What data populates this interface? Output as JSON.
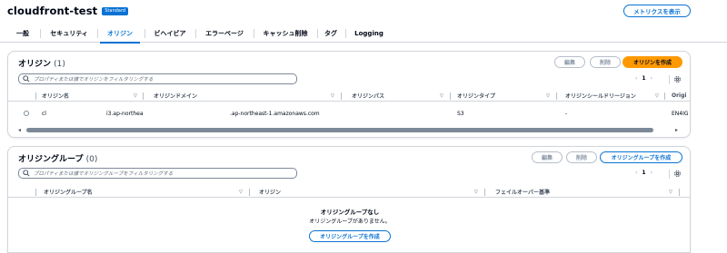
{
  "header": {
    "title": "cloudfront-test",
    "badge": "Standard",
    "metrics_button": "メトリクスを表示"
  },
  "tabs": [
    {
      "label": "一般",
      "active": false
    },
    {
      "label": "セキュリティ",
      "active": false
    },
    {
      "label": "オリジン",
      "active": true
    },
    {
      "label": "ビヘイビア",
      "active": false
    },
    {
      "label": "エラーページ",
      "active": false
    },
    {
      "label": "キャッシュ削除",
      "active": false
    },
    {
      "label": "タグ",
      "active": false
    },
    {
      "label": "Logging",
      "active": false
    }
  ],
  "origins": {
    "title": "オリジン",
    "count": "(1)",
    "edit_label": "編集",
    "delete_label": "削除",
    "create_label": "オリジンを作成",
    "search_placeholder": "プロパティまたは値でオリジンをフィルタリングする",
    "page_number": "1",
    "columns": [
      "オリジン名",
      "オリジンドメイン",
      "オリジンパス",
      "オリジンタイプ",
      "オリジンシールドリージョン",
      "Origi"
    ],
    "rows": [
      {
        "name": "cl",
        "name_tail": "i3.ap-northea",
        "domain": ".ap-northeast-1.amazonaws.com",
        "path": "",
        "type": "S3",
        "shield_region": "-",
        "extra": "EN4IG"
      }
    ]
  },
  "origin_groups": {
    "title": "オリジングループ",
    "count": "(0)",
    "edit_label": "編集",
    "delete_label": "削除",
    "create_label": "オリジングループを作成",
    "search_placeholder": "プロパティまたは値でオリジングループをフィルタリングする",
    "page_number": "1",
    "columns": [
      "オリジングループ名",
      "オリジン",
      "フェイルオーバー基準"
    ],
    "empty_title": "オリジングループなし",
    "empty_desc": "オリジングループがありません。",
    "empty_create_label": "オリジングループを作成"
  },
  "icons": {
    "search": "search-icon",
    "settings": "settings-icon",
    "prev": "chevron-left-icon",
    "next": "chevron-right-icon",
    "sort": "sort-down-icon"
  },
  "colors": {
    "accent": "#0972d3",
    "primary_button": "#ff9900",
    "text": "#000716",
    "border": "#d1d5db"
  }
}
